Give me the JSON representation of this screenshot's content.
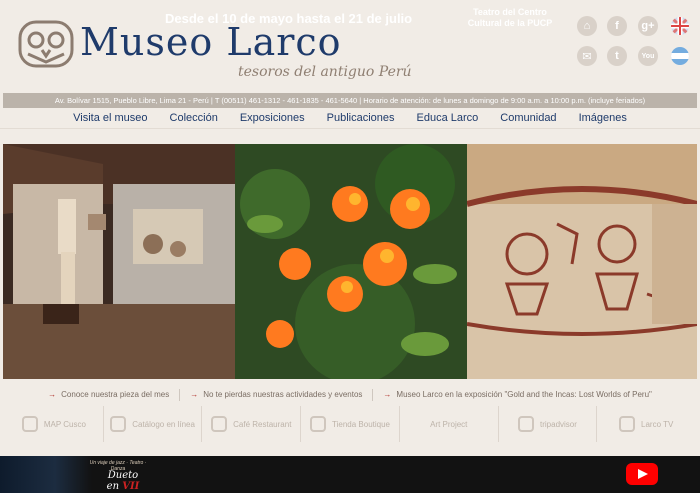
{
  "header": {
    "title": "Museo Larco",
    "subtitle": "tesoros del antiguo Perú"
  },
  "social": [
    "home-icon",
    "facebook-icon",
    "google-plus-icon",
    "english-flag-icon",
    "email-icon",
    "twitter-icon",
    "youtube-icon",
    "argentina-flag-icon"
  ],
  "infobar": "Av. Bolívar 1515, Pueblo Libre, Lima 21 - Perú | T (00511) 461-1312 - 461-1835 - 461-5640 | Horario de atención: de lunes a domingo de 9:00 a.m. a 10:00 p.m. (incluye feriados)",
  "nav": [
    "Visita el museo",
    "Colección",
    "Exposiciones",
    "Publicaciones",
    "Educa Larco",
    "Comunidad",
    "Imágenes"
  ],
  "links": [
    "Conoce nuestra pieza del mes",
    "No te pierdas nuestras actividades y eventos",
    "Museo Larco en la exposición \"Gold and the Incas: Lost Worlds of Peru\""
  ],
  "quick": [
    "MAP Cusco",
    "Catálogo en línea",
    "Café Restaurant",
    "Tienda Boutique",
    "Art Project",
    "tripadvisor",
    "Larco TV"
  ],
  "banner": {
    "small": "Un viaje de jazz · Teatro · Danza",
    "logo_prefix": "Dueto en",
    "logo_suffix": "VII",
    "headline": "Desde el 10 de mayo hasta el 21 de julio",
    "venue_line1": "Teatro del Centro",
    "venue_line2": "Cultural de la PUCP"
  },
  "colors": {
    "brand": "#1f3b6b",
    "accent": "#b0302a",
    "background": "#f1ece6"
  }
}
